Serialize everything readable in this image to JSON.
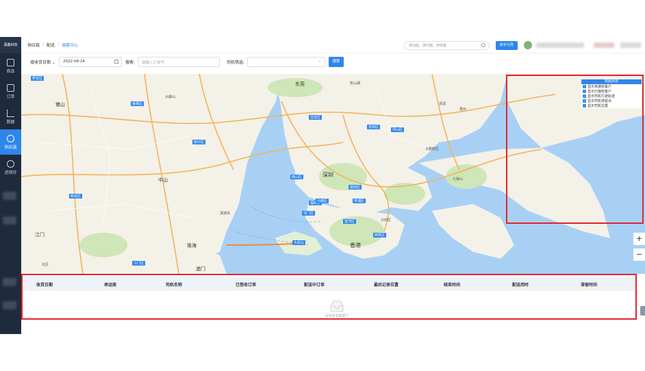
{
  "sidebar": {
    "logo": "源鑫科技",
    "items": [
      {
        "label": "商品",
        "icon": "bag-icon"
      },
      {
        "label": "订单",
        "icon": "order-icon"
      },
      {
        "label": "数据",
        "icon": "chart-icon"
      },
      {
        "label": "供应链",
        "icon": "share-icon",
        "active": true
      },
      {
        "label": "进销存",
        "icon": "inventory-icon"
      }
    ]
  },
  "header": {
    "breadcrumb": [
      "供应链",
      "配送",
      "调度中心"
    ],
    "search_placeholder": "搜功能、搜问题、搜单据",
    "guide_button": "新手引导"
  },
  "filters": {
    "date_type": "接收货日期",
    "date_value": "2022-08-24",
    "search_label": "搜索:",
    "search_placeholder": "请输入订单号",
    "driver_label": "司机筛选:",
    "driver_value": "",
    "search_button": "搜索"
  },
  "map": {
    "labels": [
      {
        "text": "罗甘区"
      },
      {
        "text": "佛山"
      },
      {
        "text": "大朗山"
      },
      {
        "text": "番禺区"
      },
      {
        "text": "南沙区"
      },
      {
        "text": "东莞"
      },
      {
        "text": "松山湖"
      },
      {
        "text": "深圳"
      },
      {
        "text": "宝安区"
      },
      {
        "text": "南山区"
      },
      {
        "text": "福田区"
      },
      {
        "text": "罗湖区"
      },
      {
        "text": "龙岗区"
      },
      {
        "text": "坪山区"
      },
      {
        "text": "大鹏新区"
      },
      {
        "text": "盐田区"
      },
      {
        "text": "中山"
      },
      {
        "text": "珠海"
      },
      {
        "text": "澳门"
      },
      {
        "text": "香港"
      },
      {
        "text": "大屿山"
      },
      {
        "text": "屯门区"
      },
      {
        "text": "元朗区"
      },
      {
        "text": "荃湾区"
      },
      {
        "text": "西贡区"
      },
      {
        "text": "惠州"
      },
      {
        "text": "七娘山"
      },
      {
        "text": "斗门区"
      },
      {
        "text": "新会区"
      },
      {
        "text": "江门"
      },
      {
        "text": "淇澳岛"
      },
      {
        "text": "清溪"
      },
      {
        "text": "沙田区"
      },
      {
        "text": "北区"
      }
    ],
    "zoom_in": "+",
    "zoom_out": "−"
  },
  "legend": {
    "title": "热图示源",
    "items": [
      "显示未接收客户",
      "显示已接收客户",
      "显示司机行驶轨迹",
      "显示司机停留点",
      "显示司机位置"
    ]
  },
  "table": {
    "columns": [
      "收货日期",
      "承运商",
      "司机名称",
      "已签收订单",
      "配送中订单",
      "最后记录位置",
      "结束时间",
      "配送用时",
      "滞留时间"
    ],
    "empty_text": "没有更多数据了"
  },
  "colors": {
    "primary": "#2f86ea",
    "sidebar": "#1e2b3c",
    "highlight": "#e3232b",
    "sea": "#a8d0f5",
    "land": "#f4f1e8"
  }
}
